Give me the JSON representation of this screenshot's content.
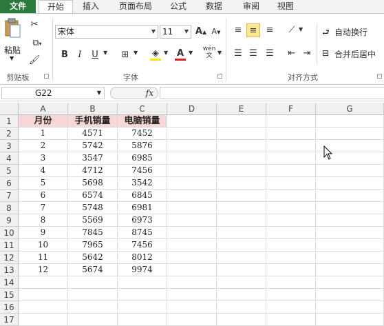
{
  "tabs": [
    "文件",
    "开始",
    "插入",
    "页面布局",
    "公式",
    "数据",
    "审阅",
    "视图"
  ],
  "clipboard": {
    "paste_label": "粘贴",
    "group_label": "剪贴板"
  },
  "font": {
    "name": "宋体",
    "size": "11",
    "group_label": "字体",
    "bold": "B",
    "italic": "I",
    "underline": "U",
    "grow": "A",
    "shrink": "A",
    "color_letter": "A",
    "wen": "wén"
  },
  "alignment": {
    "wrap_label": "自动换行",
    "merge_label": "合并后居中",
    "group_label": "对齐方式"
  },
  "formula_bar": {
    "cell_ref": "G22",
    "fx": "fx",
    "formula": ""
  },
  "columns": [
    "A",
    "B",
    "C",
    "D",
    "E",
    "F",
    "G"
  ],
  "rows": [
    "1",
    "2",
    "3",
    "4",
    "5",
    "6",
    "7",
    "8",
    "9",
    "10",
    "11",
    "12",
    "13",
    "14",
    "15",
    "16",
    "17"
  ],
  "sheet": {
    "headers": [
      "月份",
      "手机销量",
      "电脑销量"
    ],
    "data": [
      [
        "1",
        "4571",
        "7452"
      ],
      [
        "2",
        "5742",
        "5876"
      ],
      [
        "3",
        "3547",
        "6985"
      ],
      [
        "4",
        "4712",
        "7456"
      ],
      [
        "5",
        "5698",
        "3542"
      ],
      [
        "6",
        "6574",
        "6845"
      ],
      [
        "7",
        "5748",
        "6981"
      ],
      [
        "8",
        "5569",
        "6973"
      ],
      [
        "9",
        "7845",
        "8745"
      ],
      [
        "10",
        "7965",
        "7456"
      ],
      [
        "11",
        "5642",
        "8012"
      ],
      [
        "12",
        "5674",
        "9974"
      ]
    ]
  },
  "colors": {
    "file_tab": "#2a7a3b",
    "header_fill": "#f6d7d7",
    "font_color_bar": "#e02020",
    "fill_color_bar": "#ffe600"
  }
}
